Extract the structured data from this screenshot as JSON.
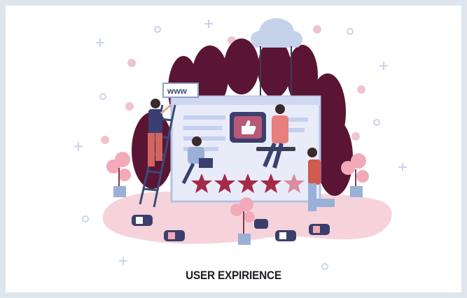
{
  "caption": "USER EXPIRIENCE",
  "browser": {
    "address_label": "www"
  },
  "rating": {
    "filled": 4,
    "total": 5
  },
  "icons": [
    "cloud-icon",
    "like-icon",
    "dislike-icon",
    "star-icon",
    "plus-icon",
    "circle-icon",
    "x-icon"
  ],
  "colors": {
    "background": "#dde6ec",
    "canvas": "#ffffff",
    "foliage": "#5a1434",
    "star": "#a52a4a",
    "pink_ground": "#f6d3da",
    "screen": "#e8ecf8",
    "caption": "#1c1c22"
  }
}
